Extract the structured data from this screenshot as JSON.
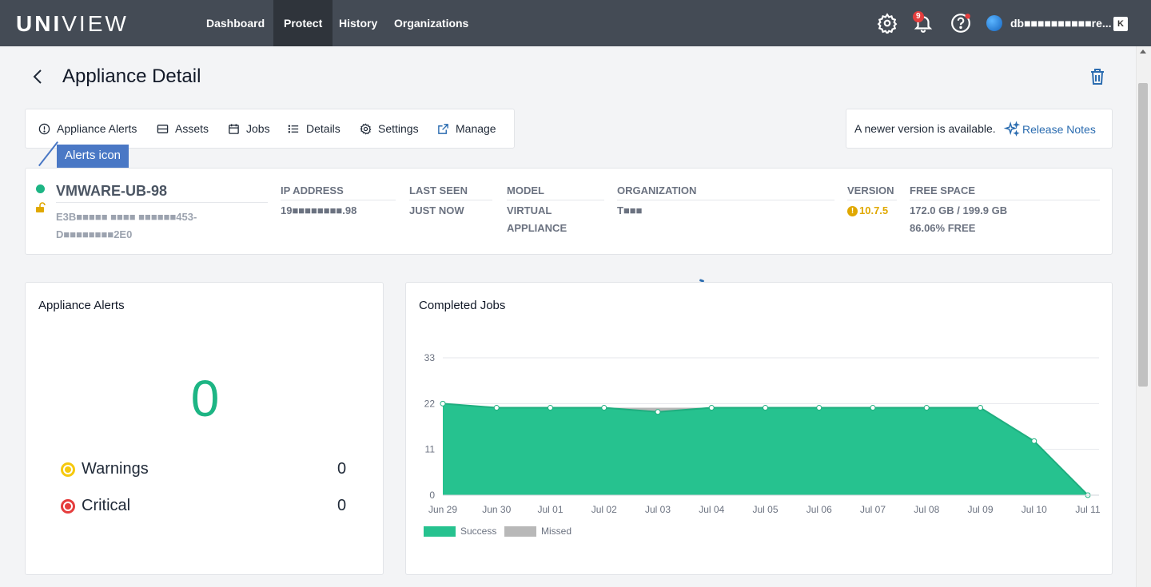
{
  "brand": {
    "logo_bold": "UNI",
    "logo_thin": "VIEW"
  },
  "nav": {
    "items": [
      {
        "label": "Dashboard"
      },
      {
        "label": "Protect"
      },
      {
        "label": "History"
      },
      {
        "label": "Organizations"
      }
    ],
    "notification_count": "9",
    "user_name": "db■■■■■■■■■■re...",
    "user_short": "K"
  },
  "header": {
    "title": "Appliance Detail"
  },
  "tabs": [
    {
      "label": "Appliance Alerts",
      "icon": "alert-circle-icon"
    },
    {
      "label": "Assets",
      "icon": "server-icon"
    },
    {
      "label": "Jobs",
      "icon": "calendar-icon"
    },
    {
      "label": "Details",
      "icon": "list-icon"
    },
    {
      "label": "Settings",
      "icon": "gear-icon"
    },
    {
      "label": "Manage",
      "icon": "external-link-icon"
    }
  ],
  "update": {
    "text": "A newer version is available.",
    "link": "Release Notes"
  },
  "tooltip": {
    "text": "Alerts icon"
  },
  "appliance": {
    "name": "VMWARE-UB-98",
    "serial_line1": "E3B■■■■■ ■■■■  ■■■■■■453-",
    "serial_line2": "D■■■■■■■■2E0",
    "status_color": "#1db584",
    "columns": {
      "ip_label": "IP ADDRESS",
      "ip_value": "19■■■■■■■■.98",
      "last_seen_label": "LAST SEEN",
      "last_seen_value": "JUST NOW",
      "model_label": "MODEL",
      "model_value_1": "VIRTUAL",
      "model_value_2": "APPLIANCE",
      "org_label": "ORGANIZATION",
      "org_value": "T■■■",
      "version_label": "VERSION",
      "version_value": "10.7.5",
      "free_label": "FREE SPACE",
      "free_value": "172.0 GB / 199.9 GB",
      "free_pct": "86.06% FREE"
    }
  },
  "alerts": {
    "title": "Appliance Alerts",
    "total": "0",
    "warnings_label": "Warnings",
    "warnings_count": "0",
    "warning_color": "#f6c90e",
    "critical_label": "Critical",
    "critical_count": "0",
    "critical_color": "#e53e3e"
  },
  "jobs": {
    "title": "Completed Jobs",
    "chart_data": {
      "type": "area",
      "title": "Completed Jobs",
      "x": [
        "Jun 29",
        "Jun 30",
        "Jul 01",
        "Jul 02",
        "Jul 03",
        "Jul 04",
        "Jul 05",
        "Jul 06",
        "Jul 07",
        "Jul 08",
        "Jul 09",
        "Jul 10",
        "Jul 11"
      ],
      "yticks": [
        0,
        11,
        22,
        33
      ],
      "ylim": [
        0,
        33
      ],
      "series": [
        {
          "name": "Success",
          "color": "#26c28f",
          "values": [
            22,
            21,
            21,
            21,
            20,
            21,
            21,
            21,
            21,
            21,
            21,
            13,
            0
          ]
        },
        {
          "name": "Missed",
          "color": "#b8b8b8",
          "values": [
            0,
            0,
            0,
            0,
            1,
            0,
            0,
            0,
            0,
            0,
            0,
            0,
            0
          ]
        }
      ],
      "grid": true,
      "legend": "bottom-left"
    }
  }
}
